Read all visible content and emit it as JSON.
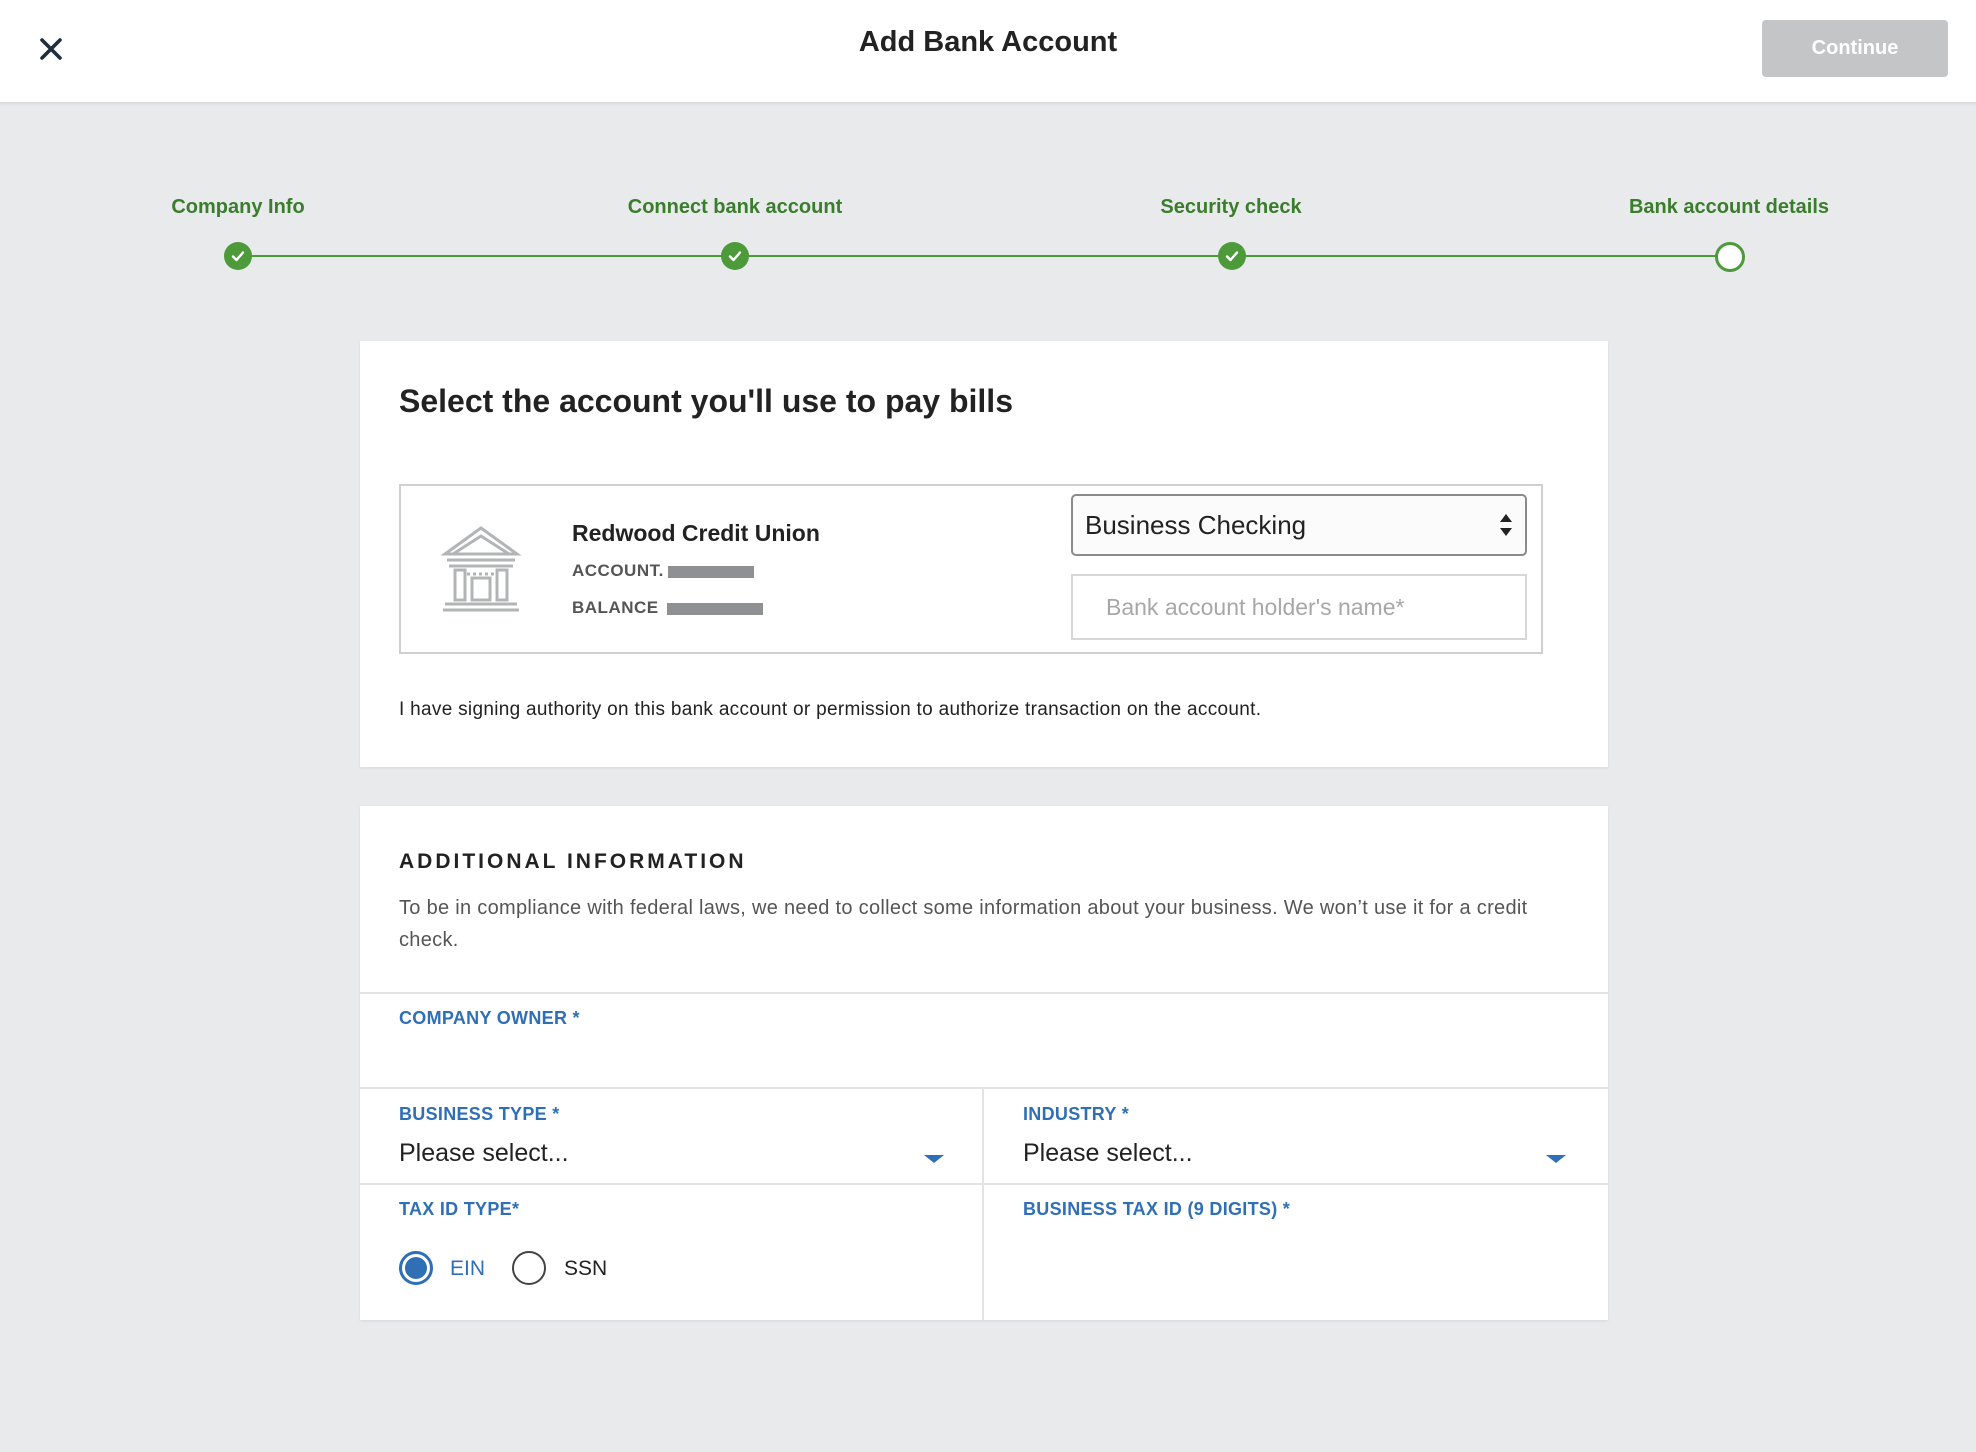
{
  "header": {
    "title": "Add Bank Account",
    "continue_label": "Continue"
  },
  "steps": [
    {
      "label": "Company Info",
      "status": "complete"
    },
    {
      "label": "Connect bank account",
      "status": "complete"
    },
    {
      "label": "Security check",
      "status": "complete"
    },
    {
      "label": "Bank account details",
      "status": "current"
    }
  ],
  "account_card": {
    "heading": "Select the account you'll use to pay bills",
    "bank_name": "Redwood Credit Union",
    "account_label": "ACCOUNT",
    "balance_label": "BALANCE",
    "account_type_selected": "Business Checking",
    "holder_name_placeholder": "Bank account holder's name*",
    "authority_text": "I have signing authority on this bank account or permission to authorize transaction on the account."
  },
  "additional_info": {
    "title": "ADDITIONAL INFORMATION",
    "description": "To be in compliance with federal laws, we need to collect some information about your business. We won’t use it for a credit check.",
    "company_owner_label": "COMPANY OWNER *",
    "business_type_label": "BUSINESS TYPE *",
    "business_type_value": "Please select...",
    "industry_label": "INDUSTRY *",
    "industry_value": "Please select...",
    "tax_id_type_label": "TAX ID TYPE*",
    "tax_id_options": [
      {
        "label": "EIN",
        "selected": true
      },
      {
        "label": "SSN",
        "selected": false
      }
    ],
    "business_tax_id_label": "BUSINESS TAX ID (9 DIGITS) *"
  },
  "colors": {
    "step_green": "#4c9a3a",
    "label_blue": "#2f6fb6",
    "disabled_button": "#c4c5c7"
  }
}
